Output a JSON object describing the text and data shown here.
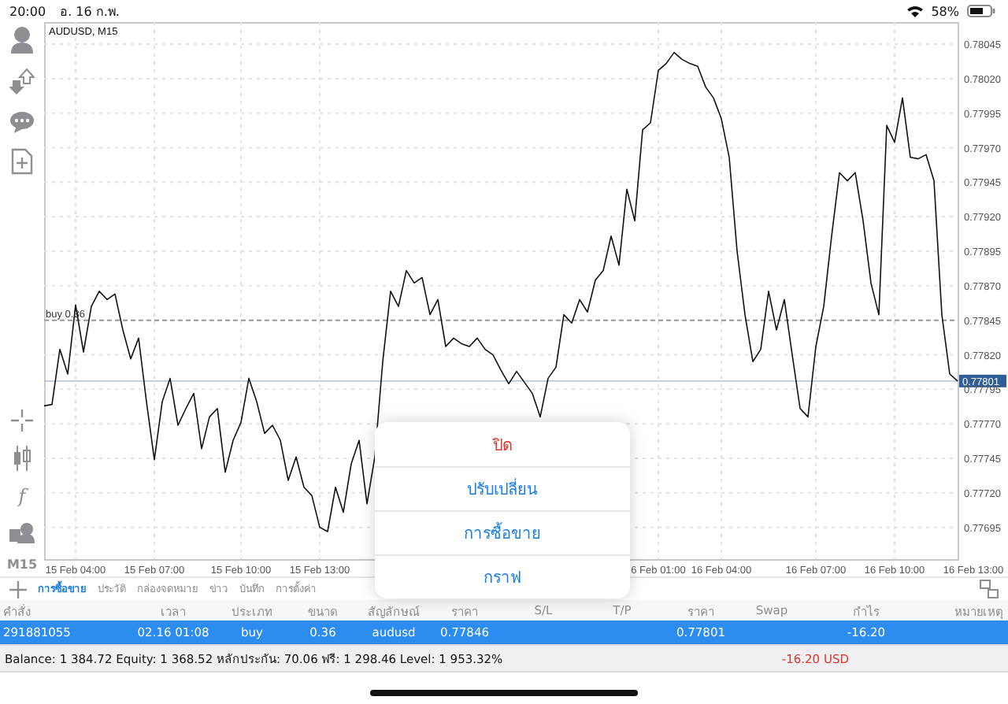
{
  "status_bar": {
    "time": "20:00",
    "date": "อ. 16 ก.พ.",
    "battery": "58%"
  },
  "toolbar": {
    "indicator_glyph": "f",
    "timeframe": "M15"
  },
  "chart": {
    "chart_data": {
      "type": "line",
      "title": "AUDUSD, M15",
      "grid": true,
      "ylim": [
        0.77672,
        0.78061
      ],
      "categories": [
        null,
        null,
        null,
        null,
        "15 Feb 04:00",
        null,
        null,
        null,
        null,
        null,
        null,
        null,
        null,
        null,
        "15 Feb 07:00",
        null,
        null,
        null,
        null,
        null,
        null,
        null,
        null,
        null,
        null,
        "15 Feb 10:00",
        null,
        null,
        null,
        null,
        null,
        null,
        null,
        null,
        null,
        "15 Feb 13:00",
        null,
        null,
        null,
        null,
        null,
        null,
        null,
        null,
        null,
        null,
        null,
        null,
        null,
        null,
        null,
        null,
        null,
        null,
        null,
        null,
        null,
        null,
        null,
        null,
        null,
        null,
        null,
        null,
        null,
        null,
        null,
        null,
        null,
        null,
        null,
        null,
        null,
        null,
        null,
        null,
        null,
        null,
        "6 Feb 01:00",
        null,
        null,
        null,
        null,
        null,
        null,
        null,
        "16 Feb 04:00",
        null,
        null,
        null,
        null,
        null,
        null,
        null,
        null,
        null,
        null,
        null,
        "16 Feb 07:00",
        null,
        null,
        null,
        null,
        null,
        null,
        null,
        null,
        null,
        "16 Feb 10:00",
        null,
        null,
        null,
        null,
        null,
        null,
        null,
        null,
        null,
        "16 Feb 13:00"
      ],
      "yticks": [
        {
          "value": 0.78045,
          "label": "0.78045"
        },
        {
          "value": 0.7802,
          "label": "0.78020"
        },
        {
          "value": 0.77995,
          "label": "0.77995"
        },
        {
          "value": 0.7797,
          "label": "0.77970"
        },
        {
          "value": 0.77945,
          "label": "0.77945"
        },
        {
          "value": 0.7792,
          "label": "0.77920"
        },
        {
          "value": 0.77895,
          "label": "0.77895"
        },
        {
          "value": 0.7787,
          "label": "0.77870"
        },
        {
          "value": 0.77845,
          "label": "0.77845"
        },
        {
          "value": 0.7782,
          "label": "0.77820"
        },
        {
          "value": 0.77795,
          "label": "0.77795"
        },
        {
          "value": 0.7777,
          "label": "0.77770"
        },
        {
          "value": 0.77745,
          "label": "0.77745"
        },
        {
          "value": 0.7772,
          "label": "0.77720"
        },
        {
          "value": 0.77695,
          "label": "0.77695"
        }
      ],
      "series": [
        {
          "color": "#111111",
          "values": [
            0.77783,
            0.77784,
            0.77824,
            0.77806,
            0.77856,
            0.77822,
            0.77855,
            0.77866,
            0.7786,
            0.77864,
            0.77838,
            0.77817,
            0.77832,
            0.77786,
            0.77744,
            0.77786,
            0.77803,
            0.77769,
            0.77781,
            0.77792,
            0.77752,
            0.77775,
            0.77781,
            0.77735,
            0.77758,
            0.77771,
            0.77803,
            0.77786,
            0.77763,
            0.77769,
            0.77758,
            0.77729,
            0.77746,
            0.77724,
            0.77718,
            0.77695,
            0.77692,
            0.77724,
            0.77706,
            0.77741,
            0.77758,
            0.77712,
            0.77746,
            0.77815,
            0.77866,
            0.77855,
            0.77881,
            0.77872,
            0.77876,
            0.77849,
            0.7786,
            0.77826,
            0.77832,
            0.77828,
            0.77826,
            0.77832,
            0.77824,
            0.7782,
            0.77809,
            0.77799,
            0.77808,
            0.778,
            0.77792,
            0.77775,
            0.77803,
            0.77811,
            0.77849,
            0.77843,
            0.7786,
            0.77851,
            0.77874,
            0.77881,
            0.77906,
            0.77885,
            0.7794,
            0.77917,
            0.77983,
            0.77988,
            0.78026,
            0.78031,
            0.78039,
            0.78034,
            0.78031,
            0.78029,
            0.78014,
            0.78006,
            0.77991,
            0.77963,
            0.77895,
            0.77849,
            0.77815,
            0.77824,
            0.77866,
            0.77838,
            0.7786,
            0.7782,
            0.77781,
            0.77775,
            0.77826,
            0.77855,
            0.77906,
            0.77952,
            0.77946,
            0.77952,
            0.77917,
            0.77872,
            0.77849,
            0.77986,
            0.77974,
            0.78006,
            0.77963,
            0.77962,
            0.77965,
            0.77946,
            0.77849,
            0.77806,
            0.77801,
            null,
            null
          ]
        }
      ],
      "ref_lines": [
        {
          "axis": "y",
          "value": 0.77845,
          "label": "buy 0.36",
          "color": "#999999"
        },
        {
          "axis": "y",
          "value": 0.77801,
          "label": "0.77801",
          "color": "#aab4cc"
        }
      ]
    }
  },
  "tabs": [
    {
      "label": "การซื้อขาย",
      "selected": true
    },
    {
      "label": "ประวัติ",
      "selected": false
    },
    {
      "label": "กล่องจดหมาย",
      "selected": false
    },
    {
      "label": "ข่าว",
      "selected": false
    },
    {
      "label": "บันทึก",
      "selected": false
    },
    {
      "label": "การตั้งค่า",
      "selected": false
    }
  ],
  "table": {
    "columns": [
      "คำสั่ง",
      "เวลา",
      "ประเภท",
      "ขนาด",
      "สัญลักษณ์",
      "ราคา",
      "S/L",
      "T/P",
      "ราคา",
      "Swap",
      "กำไร",
      "หมายเหตุ"
    ],
    "rows": [
      {
        "selected": true,
        "cells": [
          "291881055",
          "02.16 01:08",
          "buy",
          "0.36",
          "audusd",
          "0.77846",
          null,
          null,
          "0.77801",
          null,
          "-16.20",
          null
        ]
      }
    ]
  },
  "summary": {
    "text": "Balance: 1 384.72 Equity: 1 368.52 หลักประกัน: 70.06 ฟรี: 1 298.46 Level: 1 953.32%",
    "profit": "-16.20  USD"
  },
  "context_menu": {
    "items": [
      {
        "label": "ปิด",
        "kind": "destructive"
      },
      {
        "label": "ปรับเปลี่ยน",
        "kind": "action"
      },
      {
        "label": "การซื้อขาย",
        "kind": "action"
      },
      {
        "label": "กราฟ",
        "kind": "action"
      }
    ]
  }
}
